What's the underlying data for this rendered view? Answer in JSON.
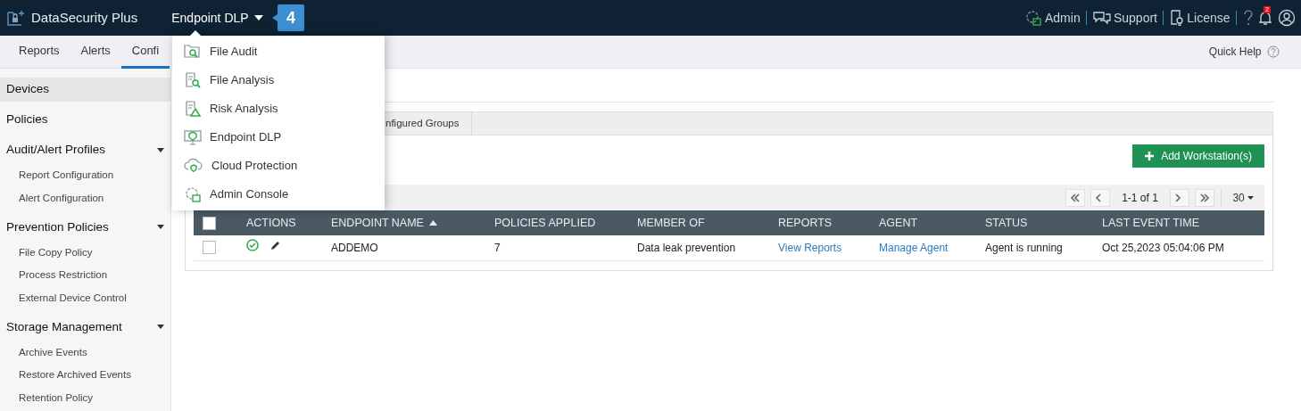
{
  "header": {
    "product": "DataSecurity Plus",
    "switcher": "Endpoint DLP",
    "step_badge": "4",
    "links": [
      {
        "label": "Admin"
      },
      {
        "label": "Support"
      },
      {
        "label": "License"
      }
    ],
    "notification_count": "2"
  },
  "nav_tabs": [
    {
      "label": "Reports",
      "selected": false
    },
    {
      "label": "Alerts",
      "selected": false
    },
    {
      "label": "Confi",
      "selected": true
    }
  ],
  "quick_help": "Quick Help",
  "sidebar": {
    "items": [
      {
        "label": "Devices",
        "kind": "link",
        "selected": true
      },
      {
        "label": "Policies",
        "kind": "link",
        "selected": false
      },
      {
        "label": "Audit/Alert Profiles",
        "kind": "group",
        "selected": false,
        "children": [
          {
            "label": "Report Configuration"
          },
          {
            "label": "Alert Configuration"
          }
        ]
      },
      {
        "label": "Prevention Policies",
        "kind": "group",
        "selected": false,
        "children": [
          {
            "label": "File Copy Policy"
          },
          {
            "label": "Process Restriction"
          },
          {
            "label": "External Device Control"
          }
        ]
      },
      {
        "label": "Storage Management",
        "kind": "group",
        "selected": false,
        "children": [
          {
            "label": "Archive Events"
          },
          {
            "label": "Restore Archived Events"
          },
          {
            "label": "Retention Policy"
          }
        ]
      }
    ]
  },
  "dropdown_menu": {
    "items": [
      {
        "label": "File Audit"
      },
      {
        "label": "File Analysis"
      },
      {
        "label": "Risk Analysis"
      },
      {
        "label": "Endpoint DLP"
      },
      {
        "label": "Cloud Protection"
      },
      {
        "label": "Admin Console"
      }
    ]
  },
  "content_tabs": [
    {
      "label": "nfigured Groups",
      "selected": false
    }
  ],
  "add_button": "Add Workstation(s)",
  "pagination": {
    "range": "1-1 of 1",
    "page_size": "30"
  },
  "table": {
    "header_checkbox": {
      "checked": false
    },
    "columns": [
      {
        "label": "ACTIONS",
        "sorted": false
      },
      {
        "label": "ENDPOINT NAME",
        "sorted": true
      },
      {
        "label": "POLICIES APPLIED",
        "sorted": false
      },
      {
        "label": "MEMBER OF",
        "sorted": false
      },
      {
        "label": "REPORTS",
        "sorted": false
      },
      {
        "label": "AGENT",
        "sorted": false
      },
      {
        "label": "STATUS",
        "sorted": false
      },
      {
        "label": "LAST EVENT TIME",
        "sorted": false
      }
    ],
    "rows": [
      {
        "checked": false,
        "endpoint_name": "ADDEMO",
        "policies_applied": "7",
        "member_of": "Data leak prevention",
        "reports": "View Reports",
        "agent": "Manage Agent",
        "status": "Agent is running",
        "last_event_time": "Oct 25,2023 05:04:06 PM"
      }
    ]
  }
}
